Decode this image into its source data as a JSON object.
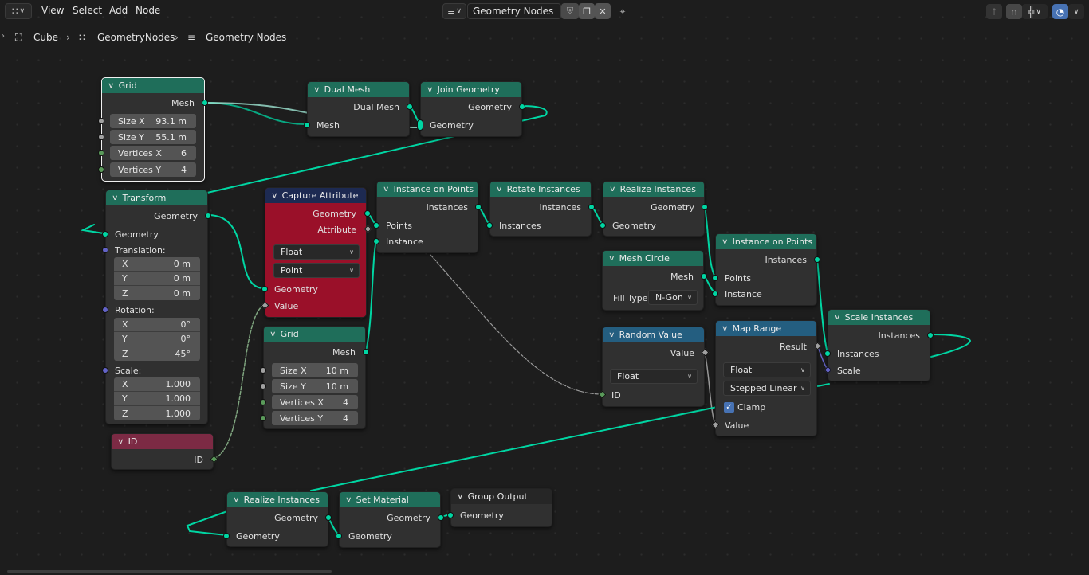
{
  "header": {
    "editor_type_icon": "geometry-nodes-icon",
    "menus": [
      "View",
      "Select",
      "Add",
      "Node"
    ],
    "node_tree_name": "Geometry Nodes",
    "node_tree_icon": "node-tree-icon",
    "fake_user_icon": "shield-icon",
    "duplicate_icon": "duplicate-icon",
    "unlink_icon": "close-icon",
    "pin_icon": "pin-icon",
    "parent_icon": "arrow-up-icon",
    "snap_icon": "magnet-icon",
    "snap_mode_icon": "snap-grid-icon",
    "overlay_icon": "overlay-icon"
  },
  "breadcrumb": {
    "items": [
      "Cube",
      "GeometryNodes",
      "Geometry Nodes"
    ],
    "icons": [
      "object-icon",
      "modifier-nodes-icon",
      "node-tree-icon"
    ]
  },
  "nodes": {
    "grid1": {
      "title": "Grid",
      "out_mesh": "Mesh",
      "fields": [
        {
          "label": "Size X",
          "value": "93.1 m"
        },
        {
          "label": "Size Y",
          "value": "55.1 m"
        },
        {
          "label": "Vertices X",
          "value": "6"
        },
        {
          "label": "Vertices Y",
          "value": "4"
        }
      ]
    },
    "dual_mesh": {
      "title": "Dual Mesh",
      "out": "Dual Mesh",
      "in": "Mesh"
    },
    "join_geometry": {
      "title": "Join Geometry",
      "out": "Geometry",
      "in": "Geometry"
    },
    "transform": {
      "title": "Transform",
      "out": "Geometry",
      "in": "Geometry",
      "translation_label": "Translation:",
      "translation": [
        {
          "axis": "X",
          "value": "0 m"
        },
        {
          "axis": "Y",
          "value": "0 m"
        },
        {
          "axis": "Z",
          "value": "0 m"
        }
      ],
      "rotation_label": "Rotation:",
      "rotation": [
        {
          "axis": "X",
          "value": "0°"
        },
        {
          "axis": "Y",
          "value": "0°"
        },
        {
          "axis": "Z",
          "value": "45°"
        }
      ],
      "scale_label": "Scale:",
      "scale": [
        {
          "axis": "X",
          "value": "1.000"
        },
        {
          "axis": "Y",
          "value": "1.000"
        },
        {
          "axis": "Z",
          "value": "1.000"
        }
      ]
    },
    "capture_attribute": {
      "title": "Capture Attribute",
      "out_geometry": "Geometry",
      "out_attribute": "Attribute",
      "data_type": "Float",
      "domain": "Point",
      "in_geometry": "Geometry",
      "in_value": "Value"
    },
    "grid2": {
      "title": "Grid",
      "out_mesh": "Mesh",
      "fields": [
        {
          "label": "Size X",
          "value": "10 m"
        },
        {
          "label": "Size Y",
          "value": "10 m"
        },
        {
          "label": "Vertices X",
          "value": "4"
        },
        {
          "label": "Vertices Y",
          "value": "4"
        }
      ]
    },
    "id": {
      "title": "ID",
      "out": "ID"
    },
    "instance_on_points1": {
      "title": "Instance on Points",
      "out": "Instances",
      "in_points": "Points",
      "in_instance": "Instance"
    },
    "rotate_instances": {
      "title": "Rotate Instances",
      "out": "Instances",
      "in": "Instances"
    },
    "realize_instances1": {
      "title": "Realize Instances",
      "out": "Geometry",
      "in": "Geometry"
    },
    "mesh_circle": {
      "title": "Mesh Circle",
      "out": "Mesh",
      "fill_type_label": "Fill Type",
      "fill_type": "N-Gon"
    },
    "instance_on_points2": {
      "title": "Instance on Points",
      "out": "Instances",
      "in_points": "Points",
      "in_instance": "Instance"
    },
    "random_value": {
      "title": "Random Value",
      "out": "Value",
      "data_type": "Float",
      "in_id": "ID"
    },
    "map_range": {
      "title": "Map Range",
      "out": "Result",
      "data_type": "Float",
      "interpolation": "Stepped Linear",
      "clamp_label": "Clamp",
      "clamp": true,
      "in_value": "Value"
    },
    "scale_instances": {
      "title": "Scale Instances",
      "out": "Instances",
      "in_instances": "Instances",
      "in_scale": "Scale"
    },
    "realize_instances2": {
      "title": "Realize Instances",
      "out": "Geometry",
      "in": "Geometry"
    },
    "set_material": {
      "title": "Set Material",
      "out": "Geometry",
      "in": "Geometry"
    },
    "group_output": {
      "title": "Group Output",
      "in": "Geometry"
    }
  },
  "colors": {
    "geometry_header": "#1f6e5a",
    "function_header": "#245e80",
    "attribute_header": "#1d2a52",
    "input_header": "#7c2a44",
    "capture_body": "#9a1029",
    "geometry_socket": "#00d6a3",
    "float_socket": "#a1a1a1",
    "int_socket": "#5a9a5a",
    "vector_socket": "#6363c7",
    "accent": "#4772b3"
  }
}
